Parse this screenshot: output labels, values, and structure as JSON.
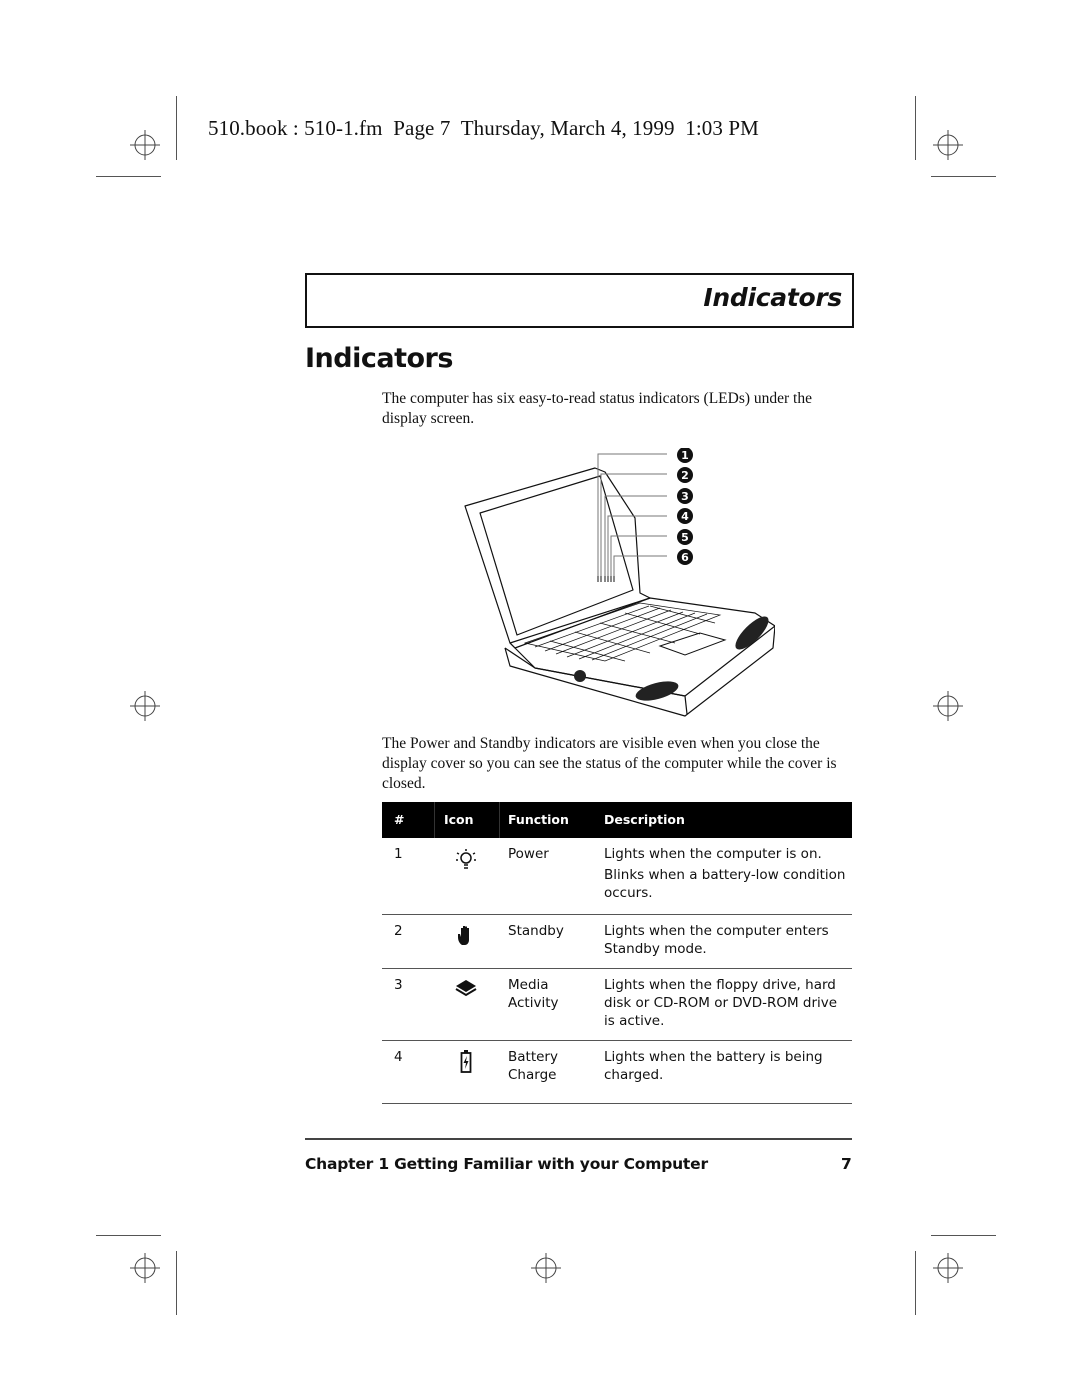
{
  "slug": "510.book : 510-1.fm  Page 7  Thursday, March 4, 1999  1:03 PM",
  "running_header": "Indicators",
  "section_title": "Indicators",
  "intro_paragraph": "The computer has six easy-to-read status indicators (LEDs) under the display screen.",
  "figure": {
    "description": "laptop-with-indicator-callouts",
    "callouts": [
      "1",
      "2",
      "3",
      "4",
      "5",
      "6"
    ]
  },
  "visible_paragraph": "The Power and Standby indicators are visible even when you close the display cover so you can see the status of the computer while the cover is closed.",
  "table": {
    "headers": [
      "#",
      "Icon",
      "Function",
      "Description"
    ],
    "rows": [
      {
        "num": "1",
        "icon": "power-lightbulb-icon",
        "function": "Power",
        "description_lines": [
          "Lights when the computer is on.",
          "Blinks when a battery-low condition occurs."
        ]
      },
      {
        "num": "2",
        "icon": "standby-hand-icon",
        "function": "Standby",
        "description_lines": [
          "Lights when the computer enters Standby mode."
        ]
      },
      {
        "num": "3",
        "icon": "media-activity-disk-icon",
        "function": "Media Activity",
        "description_lines": [
          "Lights when the floppy drive, hard disk or CD-ROM or DVD-ROM drive is active."
        ]
      },
      {
        "num": "4",
        "icon": "battery-charge-icon",
        "function": "Battery Charge",
        "description_lines": [
          "Lights when the battery is being charged."
        ]
      }
    ]
  },
  "footer": {
    "chapter": "Chapter 1  Getting Familiar with your Computer",
    "page_number": "7"
  }
}
